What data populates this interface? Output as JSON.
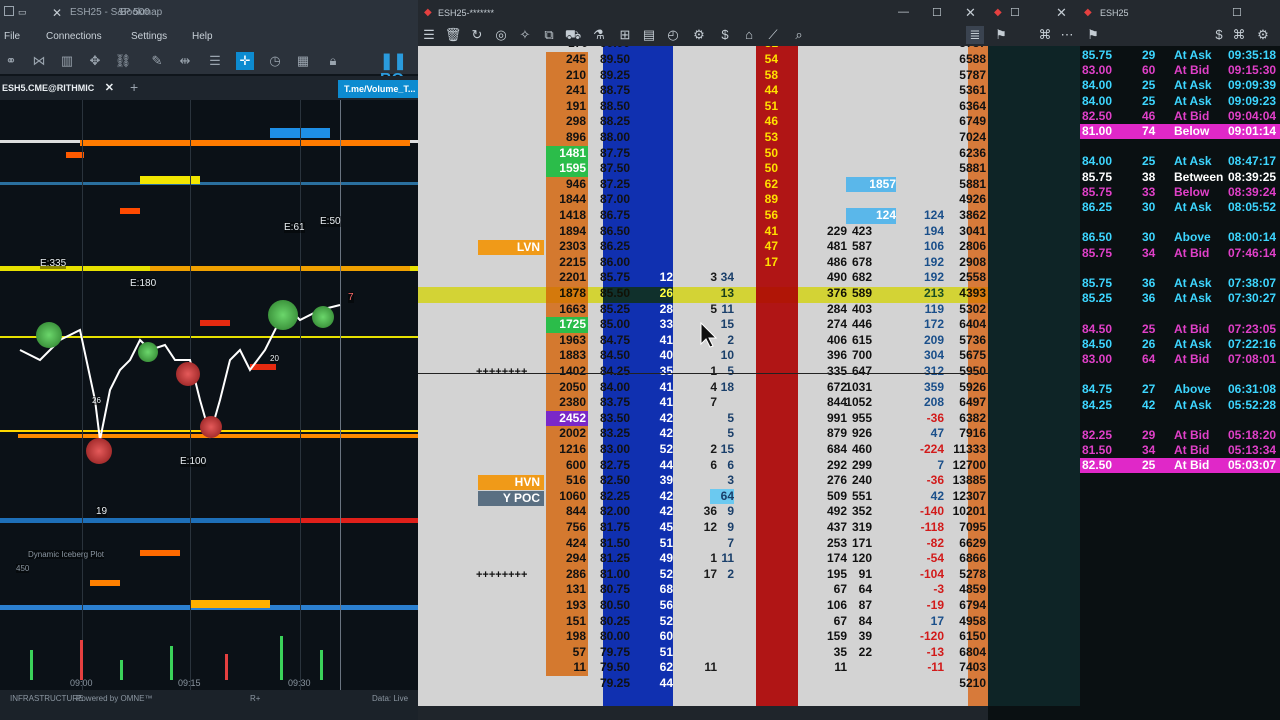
{
  "bookmap": {
    "title": "ESH25 - S&P 500",
    "title_suffix": "Bookmap",
    "menu": [
      "File",
      "Connections",
      "Settings",
      "Help"
    ],
    "tab_instrument": "ESH5.CME@RITHMIC",
    "tab_add": "+",
    "tab_close": "✕",
    "tab_link": "T.me/Volume_T...",
    "brand_partial": "BO",
    "labels": {
      "e335": "E:335",
      "e180": "E:180",
      "e61": "E:61",
      "e50": "E:50",
      "e100": "E:100",
      "marker7": "7",
      "marker20": "20",
      "marker26": "26",
      "marker19": "19",
      "iceberg": "Dynamic Iceberg Plot",
      "axis_val": "450"
    },
    "time_ticks": [
      "09:00",
      "09:15",
      "09:30"
    ],
    "status_left": "INFRASTRUCTURE",
    "status_powered": "Powered by OMNE™",
    "status_r": "R+",
    "status_data": "Data: Live"
  },
  "dom": {
    "title": "ESH25-*******",
    "rows": [
      {
        "vol": "245",
        "price": "89.50",
        "bid": "",
        "ask": "54",
        "a1": "",
        "a2": "",
        "s1": "",
        "s2": "",
        "tot": "6588"
      },
      {
        "vol": "210",
        "price": "89.25",
        "bid": "",
        "ask": "58",
        "a1": "",
        "a2": "",
        "s1": "",
        "s2": "",
        "tot": "5787"
      },
      {
        "vol": "241",
        "price": "88.75",
        "bid": "",
        "ask": "44",
        "a1": "",
        "a2": "",
        "s1": "",
        "s2": "",
        "tot": "5361"
      },
      {
        "vol": "191",
        "price": "88.50",
        "bid": "",
        "ask": "51",
        "a1": "",
        "a2": "",
        "s1": "",
        "s2": "",
        "tot": "6364"
      },
      {
        "vol": "298",
        "price": "88.25",
        "bid": "",
        "ask": "46",
        "a1": "",
        "a2": "",
        "s1": "",
        "s2": "",
        "tot": "6749"
      },
      {
        "vol": "896",
        "price": "88.00",
        "bid": "",
        "ask": "53",
        "a1": "",
        "a2": "",
        "s1": "",
        "s2": "",
        "tot": "7024"
      },
      {
        "vol": "1481",
        "price": "87.75",
        "bid": "",
        "ask": "50",
        "a1": "",
        "a2": "",
        "s1": "",
        "s2": "",
        "tot": "6236"
      },
      {
        "vol": "1595",
        "price": "87.50",
        "bid": "",
        "ask": "50",
        "a1": "",
        "a2": "",
        "s1": "",
        "s2": "",
        "tot": "5881"
      },
      {
        "vol": "946",
        "price": "87.25",
        "bid": "",
        "ask": "62",
        "a1": "",
        "a2": "",
        "s1": "1857",
        "s2": "",
        "tot": "5881"
      },
      {
        "vol": "1844",
        "price": "87.00",
        "bid": "",
        "ask": "89",
        "a1": "",
        "a2": "",
        "s1": "",
        "s2": "",
        "tot": "4926"
      },
      {
        "vol": "1418",
        "price": "86.75",
        "bid": "",
        "ask": "56",
        "a1": "",
        "a2": "",
        "s1": "124",
        "s2": "124",
        "tot": "3862"
      },
      {
        "vol": "1894",
        "price": "86.50",
        "bid": "",
        "ask": "41",
        "a1": "229",
        "a2": "423",
        "s1": "",
        "s2": "194",
        "tot": "3041"
      },
      {
        "vol": "2303",
        "price": "86.25",
        "bid": "",
        "ask": "47",
        "a1": "481",
        "a2": "587",
        "s1": "",
        "s2": "106",
        "tot": "2806"
      },
      {
        "vol": "2215",
        "price": "86.00",
        "bid": "",
        "ask": "17",
        "a1": "486",
        "a2": "678",
        "s1": "",
        "s2": "192",
        "tot": "2908"
      },
      {
        "vol": "2201",
        "price": "85.75",
        "bid": "12",
        "ask": "",
        "a1": "490",
        "a2": "682",
        "s1": "",
        "s2": "192",
        "tot": "2558",
        "t1": "3",
        "t2": "34"
      },
      {
        "vol": "1878",
        "price": "85.50",
        "bid": "26",
        "ask": "",
        "a1": "376",
        "a2": "589",
        "s1": "",
        "s2": "213",
        "tot": "4393",
        "t1": "",
        "t2": "13"
      },
      {
        "vol": "1663",
        "price": "85.25",
        "bid": "28",
        "ask": "",
        "a1": "284",
        "a2": "403",
        "s1": "",
        "s2": "119",
        "tot": "5302",
        "t1": "5",
        "t2": "11"
      },
      {
        "vol": "1725",
        "price": "85.00",
        "bid": "33",
        "ask": "",
        "a1": "274",
        "a2": "446",
        "s1": "",
        "s2": "172",
        "tot": "6404",
        "t1": "",
        "t2": "15"
      },
      {
        "vol": "1963",
        "price": "84.75",
        "bid": "41",
        "ask": "",
        "a1": "406",
        "a2": "615",
        "s1": "",
        "s2": "209",
        "tot": "5736",
        "t1": "",
        "t2": "2"
      },
      {
        "vol": "1883",
        "price": "84.50",
        "bid": "40",
        "ask": "",
        "a1": "396",
        "a2": "700",
        "s1": "",
        "s2": "304",
        "tot": "5675",
        "t1": "",
        "t2": "10"
      },
      {
        "vol": "1402",
        "price": "84.25",
        "bid": "35",
        "ask": "",
        "a1": "335",
        "a2": "647",
        "s1": "",
        "s2": "312",
        "tot": "5950",
        "t1": "1",
        "t2": "5"
      },
      {
        "vol": "2050",
        "price": "84.00",
        "bid": "41",
        "ask": "",
        "a1": "672",
        "a2": "1031",
        "s1": "",
        "s2": "359",
        "tot": "5926",
        "t1": "4",
        "t2": "18"
      },
      {
        "vol": "2380",
        "price": "83.75",
        "bid": "41",
        "ask": "",
        "a1": "844",
        "a2": "1052",
        "s1": "",
        "s2": "208",
        "tot": "6497",
        "t1": "7",
        "t2": ""
      },
      {
        "vol": "2452",
        "price": "83.50",
        "bid": "42",
        "ask": "",
        "a1": "991",
        "a2": "955",
        "s1": "",
        "s2": "-36",
        "tot": "6382",
        "t1": "",
        "t2": "5"
      },
      {
        "vol": "2002",
        "price": "83.25",
        "bid": "42",
        "ask": "",
        "a1": "879",
        "a2": "926",
        "s1": "",
        "s2": "47",
        "tot": "7916",
        "t1": "",
        "t2": "5"
      },
      {
        "vol": "1216",
        "price": "83.00",
        "bid": "52",
        "ask": "",
        "a1": "684",
        "a2": "460",
        "s1": "",
        "s2": "-224",
        "tot": "11333",
        "t1": "2",
        "t2": "15"
      },
      {
        "vol": "600",
        "price": "82.75",
        "bid": "44",
        "ask": "",
        "a1": "292",
        "a2": "299",
        "s1": "",
        "s2": "7",
        "tot": "12700",
        "t1": "6",
        "t2": "6"
      },
      {
        "vol": "516",
        "price": "82.50",
        "bid": "39",
        "ask": "",
        "a1": "276",
        "a2": "240",
        "s1": "",
        "s2": "-36",
        "tot": "13885",
        "t1": "",
        "t2": "3"
      },
      {
        "vol": "1060",
        "price": "82.25",
        "bid": "42",
        "ask": "",
        "a1": "509",
        "a2": "551",
        "s1": "",
        "s2": "42",
        "tot": "12307",
        "t1": "1",
        "t2": "64"
      },
      {
        "vol": "844",
        "price": "82.00",
        "bid": "42",
        "ask": "",
        "a1": "492",
        "a2": "352",
        "s1": "",
        "s2": "-140",
        "tot": "10201",
        "t1": "36",
        "t2": "9"
      },
      {
        "vol": "756",
        "price": "81.75",
        "bid": "45",
        "ask": "",
        "a1": "437",
        "a2": "319",
        "s1": "",
        "s2": "-118",
        "tot": "7095",
        "t1": "12",
        "t2": "9"
      },
      {
        "vol": "424",
        "price": "81.50",
        "bid": "51",
        "ask": "",
        "a1": "253",
        "a2": "171",
        "s1": "",
        "s2": "-82",
        "tot": "6629",
        "t1": "",
        "t2": "7"
      },
      {
        "vol": "294",
        "price": "81.25",
        "bid": "49",
        "ask": "",
        "a1": "174",
        "a2": "120",
        "s1": "",
        "s2": "-54",
        "tot": "6866",
        "t1": "1",
        "t2": "11"
      },
      {
        "vol": "286",
        "price": "81.00",
        "bid": "52",
        "ask": "",
        "a1": "195",
        "a2": "91",
        "s1": "",
        "s2": "-104",
        "tot": "5278",
        "t1": "17",
        "t2": "2"
      },
      {
        "vol": "131",
        "price": "80.75",
        "bid": "68",
        "ask": "",
        "a1": "67",
        "a2": "64",
        "s1": "",
        "s2": "-3",
        "tot": "4859",
        "t1": "",
        "t2": ""
      },
      {
        "vol": "193",
        "price": "80.50",
        "bid": "56",
        "ask": "",
        "a1": "106",
        "a2": "87",
        "s1": "",
        "s2": "-19",
        "tot": "6794",
        "t1": "",
        "t2": ""
      },
      {
        "vol": "151",
        "price": "80.25",
        "bid": "52",
        "ask": "",
        "a1": "67",
        "a2": "84",
        "s1": "",
        "s2": "17",
        "tot": "4958",
        "t1": "",
        "t2": ""
      },
      {
        "vol": "198",
        "price": "80.00",
        "bid": "60",
        "ask": "",
        "a1": "159",
        "a2": "39",
        "s1": "",
        "s2": "-120",
        "tot": "6150",
        "t1": "",
        "t2": ""
      },
      {
        "vol": "57",
        "price": "79.75",
        "bid": "51",
        "ask": "",
        "a1": "35",
        "a2": "22",
        "s1": "",
        "s2": "-13",
        "tot": "6804",
        "t1": "",
        "t2": ""
      },
      {
        "vol": "11",
        "price": "79.50",
        "bid": "62",
        "ask": "",
        "a1": "11",
        "a2": "",
        "s1": "",
        "s2": "-11",
        "tot": "7403",
        "t1": "11",
        "t2": ""
      }
    ],
    "markers": {
      "lvn": "LVN",
      "hvn": "HVN",
      "ypoc": "Y POC",
      "plus1": "++++++++",
      "plus2": "++++++++"
    },
    "top_partial": {
      "vol": "170",
      "price": "90.00",
      "tot": "5787",
      "ask": "51"
    },
    "bottom_partial": {
      "price": "79.25",
      "tot": "5210",
      "bid": "44"
    }
  },
  "ts": {
    "title": "ESH25",
    "rows": [
      {
        "price": "85.75",
        "size": "29",
        "label": "At Ask",
        "time": "09:35:18",
        "color": "#3dd6ff",
        "bg": ""
      },
      {
        "price": "83.00",
        "size": "60",
        "label": "At Bid",
        "time": "09:15:30",
        "color": "#e040c8",
        "bg": ""
      },
      {
        "price": "84.00",
        "size": "25",
        "label": "At Ask",
        "time": "09:09:39",
        "color": "#3dd6ff",
        "bg": ""
      },
      {
        "price": "84.00",
        "size": "25",
        "label": "At Ask",
        "time": "09:09:23",
        "color": "#3dd6ff",
        "bg": ""
      },
      {
        "price": "82.50",
        "size": "46",
        "label": "At Bid",
        "time": "09:04:04",
        "color": "#e040c8",
        "bg": ""
      },
      {
        "price": "81.00",
        "size": "74",
        "label": "Below",
        "time": "09:01:14",
        "color": "#ffffff",
        "bg": "#e028c8"
      },
      {
        "price": "84.00",
        "size": "25",
        "label": "At Ask",
        "time": "08:47:17",
        "color": "#3dd6ff",
        "bg": ""
      },
      {
        "price": "85.75",
        "size": "38",
        "label": "Between",
        "time": "08:39:25",
        "color": "#ffffff",
        "bg": ""
      },
      {
        "price": "85.75",
        "size": "33",
        "label": "Below",
        "time": "08:39:24",
        "color": "#e040c8",
        "bg": ""
      },
      {
        "price": "86.25",
        "size": "30",
        "label": "At Ask",
        "time": "08:05:52",
        "color": "#3dd6ff",
        "bg": ""
      },
      {
        "price": "86.50",
        "size": "30",
        "label": "Above",
        "time": "08:00:14",
        "color": "#3dd6ff",
        "bg": ""
      },
      {
        "price": "85.75",
        "size": "34",
        "label": "At Bid",
        "time": "07:46:14",
        "color": "#e040c8",
        "bg": ""
      },
      {
        "price": "85.75",
        "size": "36",
        "label": "At Ask",
        "time": "07:38:07",
        "color": "#3dd6ff",
        "bg": ""
      },
      {
        "price": "85.25",
        "size": "36",
        "label": "At Ask",
        "time": "07:30:27",
        "color": "#3dd6ff",
        "bg": ""
      },
      {
        "price": "84.50",
        "size": "25",
        "label": "At Bid",
        "time": "07:23:05",
        "color": "#e040c8",
        "bg": ""
      },
      {
        "price": "84.50",
        "size": "26",
        "label": "At Ask",
        "time": "07:22:16",
        "color": "#3dd6ff",
        "bg": ""
      },
      {
        "price": "83.00",
        "size": "64",
        "label": "At Bid",
        "time": "07:08:01",
        "color": "#e040c8",
        "bg": ""
      },
      {
        "price": "84.75",
        "size": "27",
        "label": "Above",
        "time": "06:31:08",
        "color": "#3dd6ff",
        "bg": ""
      },
      {
        "price": "84.25",
        "size": "42",
        "label": "At Ask",
        "time": "05:52:28",
        "color": "#3dd6ff",
        "bg": ""
      },
      {
        "price": "82.25",
        "size": "29",
        "label": "At Bid",
        "time": "05:18:20",
        "color": "#e040c8",
        "bg": ""
      },
      {
        "price": "81.50",
        "size": "34",
        "label": "At Bid",
        "time": "05:13:34",
        "color": "#e040c8",
        "bg": ""
      },
      {
        "price": "82.50",
        "size": "25",
        "label": "At Bid",
        "time": "05:03:07",
        "color": "#ffffff",
        "bg": "#e028c8"
      }
    ]
  }
}
